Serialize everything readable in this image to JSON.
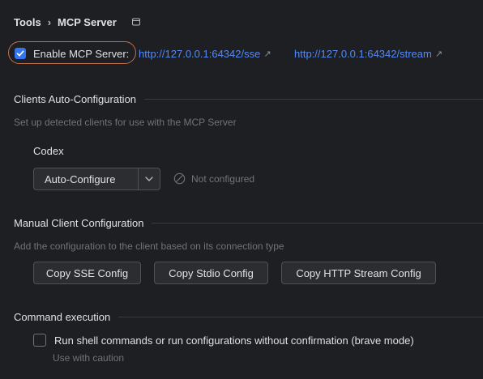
{
  "breadcrumb": {
    "parent": "Tools",
    "separator": "›",
    "current": "MCP Server",
    "pin_icon": "window-icon"
  },
  "enable": {
    "label": "Enable MCP Server:",
    "checked": true,
    "sse_url": "http://127.0.0.1:64342/sse",
    "stream_url": "http://127.0.0.1:64342/stream",
    "link_icon": "external-link-arrow-icon"
  },
  "clients_auto": {
    "title": "Clients Auto-Configuration",
    "description": "Set up detected clients for use with the MCP Server",
    "client_name": "Codex",
    "select_value": "Auto-Configure",
    "status": "Not configured"
  },
  "manual": {
    "title": "Manual Client Configuration",
    "description": "Add the configuration to the client based on its connection type",
    "buttons": [
      "Copy SSE Config",
      "Copy Stdio Config",
      "Copy HTTP Stream Config"
    ]
  },
  "command": {
    "title": "Command execution",
    "brave_label": "Run shell commands or run configurations without confirmation (brave mode)",
    "brave_checked": false,
    "caution": "Use with caution"
  },
  "colors": {
    "background": "#1e1f22",
    "accent": "#3574f0",
    "link": "#548af7",
    "highlight_ring": "#c2704a"
  }
}
